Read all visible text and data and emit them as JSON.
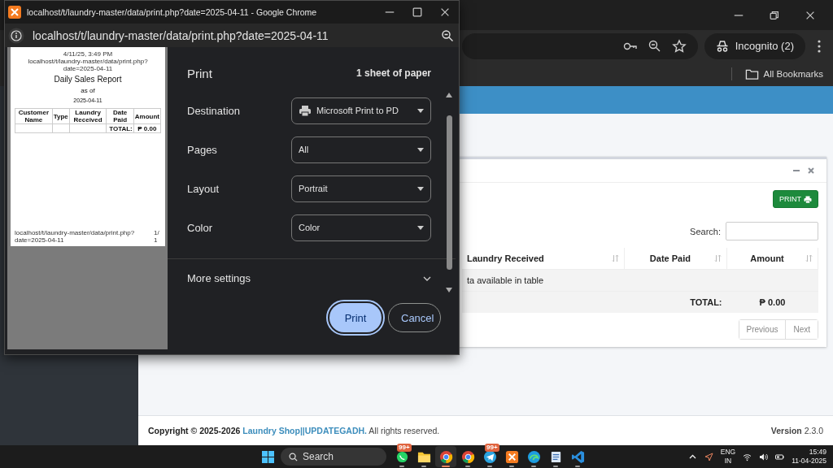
{
  "browser": {
    "window_buttons": [
      {
        "kind": "minimize"
      },
      {
        "kind": "restore"
      },
      {
        "kind": "close"
      }
    ],
    "toolbar_icons": [
      {
        "kind": "key"
      },
      {
        "kind": "zoom"
      },
      {
        "kind": "star"
      }
    ],
    "profile": "Incognito (2)",
    "bookmarks": "All Bookmarks"
  },
  "page": {
    "card": {
      "tools": [
        {
          "kind": "minus"
        },
        {
          "kind": "close"
        }
      ],
      "print_button": "PRINT",
      "search_label": "Search:",
      "columns": [
        "Laundry Received",
        "Date Paid",
        "Amount"
      ],
      "empty_message": "ta available in table",
      "total_label": "TOTAL:",
      "total_value": "₱ 0.00",
      "pagination": [
        "Previous",
        "Next"
      ]
    },
    "footer": {
      "copyright": "Copyright © 2025-2026",
      "link": "Laundry Shop||UPDATEGADH.",
      "rights": "All rights reserved.",
      "version": "**Version** 2.3.0"
    }
  },
  "print_window": {
    "title": "localhost/t/laundry-master/data/print.php?date=2025-04-11 - Google Chrome",
    "window_buttons": [
      {
        "kind": "minimize"
      },
      {
        "kind": "maximize"
      },
      {
        "kind": "close"
      }
    ],
    "url": "localhost/t/laundry-master/data/print.php?date=2025-04-11",
    "preview": {
      "timestamp": "4/11/25, 3:49 PM",
      "header_url": "localhost/t/laundry-master/data/print.php?date=2025-04-11",
      "title": "Daily Sales Report",
      "subtitle": "as of",
      "date": "2025-04-11",
      "columns": [
        "Customer Name",
        "Type",
        "Laundry Received",
        "Date Paid",
        "Amount"
      ],
      "total_label": "TOTAL:",
      "total_value": "₱ 0.00",
      "footer_url": "localhost/t/laundry-master/data/print.php?date=2025-04-11",
      "page_number": "1/1"
    },
    "panel": {
      "heading": "Print",
      "sheets": "1 sheet of paper",
      "settings": [
        {
          "label": "Destination",
          "value": "Microsoft Print to PD",
          "kind": "destination"
        },
        {
          "label": "Pages",
          "value": "All",
          "kind": "select"
        },
        {
          "label": "Layout",
          "value": "Portrait",
          "kind": "select"
        },
        {
          "label": "Color",
          "value": "Color",
          "kind": "select"
        }
      ],
      "more": "More settings",
      "buttons": [
        {
          "label": "Print",
          "kind": "primary"
        },
        {
          "label": "Cancel",
          "kind": "secondary"
        }
      ]
    }
  },
  "taskbar": {
    "search": "Search",
    "apps": [
      {
        "kind": "chat",
        "badge": "99+",
        "active": false
      },
      {
        "kind": "folder",
        "active": false
      },
      {
        "kind": "browser",
        "active": true
      },
      {
        "kind": "browser",
        "active": false
      },
      {
        "kind": "plane",
        "badge": "99+",
        "active": false
      },
      {
        "kind": "logo",
        "active": false
      },
      {
        "kind": "wave",
        "active": false
      },
      {
        "kind": "notepad",
        "active": false
      },
      {
        "kind": "code",
        "active": false
      }
    ],
    "language": [
      "ENG",
      "IN"
    ],
    "time": "15:49",
    "date": "11-04-2025"
  }
}
